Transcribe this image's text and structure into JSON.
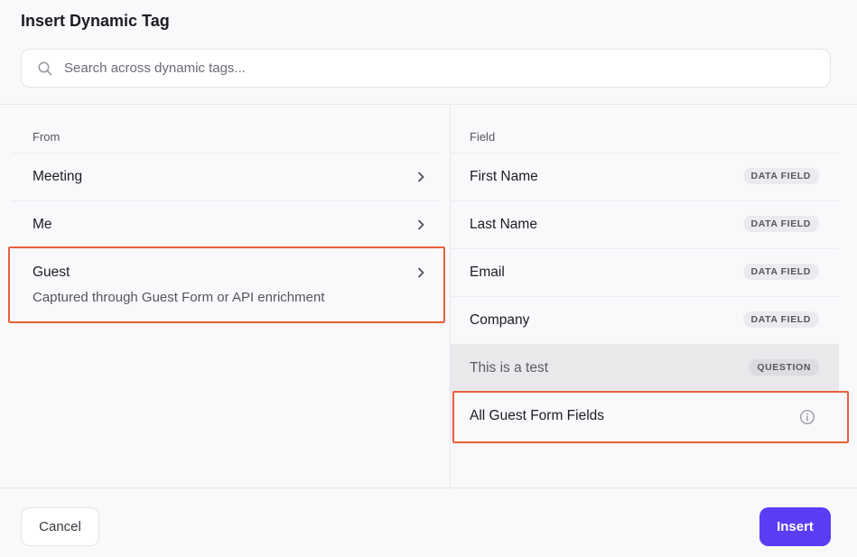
{
  "dialog": {
    "title": "Insert Dynamic Tag"
  },
  "search": {
    "placeholder": "Search across dynamic tags...",
    "value": "",
    "icon": "search-icon"
  },
  "from": {
    "header": "From",
    "items": [
      {
        "label": "Meeting",
        "sub": ""
      },
      {
        "label": "Me",
        "sub": ""
      },
      {
        "label": "Guest",
        "sub": "Captured through Guest Form or API enrichment"
      }
    ]
  },
  "field": {
    "header": "Field",
    "items": [
      {
        "label": "First Name",
        "badge": "DATA FIELD"
      },
      {
        "label": "Last Name",
        "badge": "DATA FIELD"
      },
      {
        "label": "Email",
        "badge": "DATA FIELD"
      },
      {
        "label": "Company",
        "badge": "DATA FIELD"
      },
      {
        "label": "This is a test",
        "badge": "QUESTION"
      },
      {
        "label": "All Guest Form Fields",
        "icon": "info-icon"
      }
    ]
  },
  "footer": {
    "cancel_label": "Cancel",
    "insert_label": "Insert"
  },
  "colors": {
    "accent": "#5a3df5",
    "highlight": "#e8603c"
  }
}
